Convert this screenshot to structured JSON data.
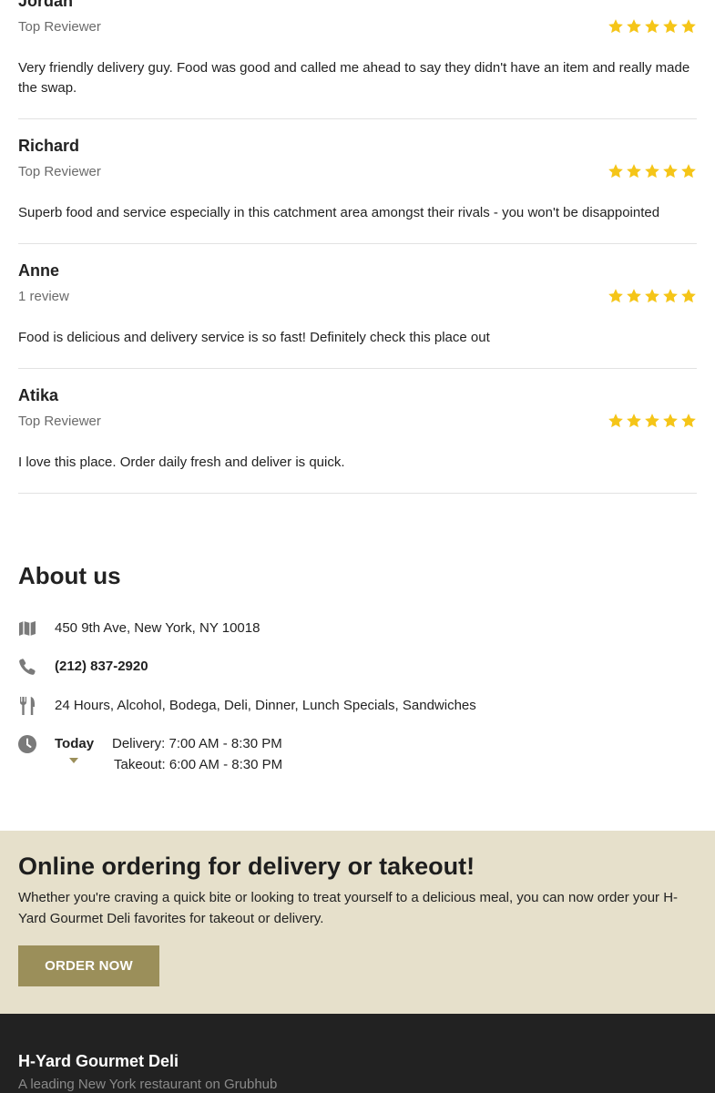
{
  "reviews": [
    {
      "name": "Jordan",
      "badge": "Top Reviewer",
      "rating": 5,
      "text": "Very friendly delivery guy. Food was good and called me ahead to say they didn't have an item and really made the swap."
    },
    {
      "name": "Richard",
      "badge": "Top Reviewer",
      "rating": 5,
      "text": "Superb food and service especially in this catchment area amongst their rivals - you won't be disappointed"
    },
    {
      "name": "Anne",
      "badge": "1 review",
      "rating": 5,
      "text": "Food is delicious and delivery service is so fast! Definitely check this place out"
    },
    {
      "name": "Atika",
      "badge": "Top Reviewer",
      "rating": 5,
      "text": "I love this place. Order daily fresh and deliver is quick."
    }
  ],
  "about": {
    "title": "About us",
    "address": "450 9th Ave, New York, NY 10018",
    "phone": "(212) 837-2920",
    "categories": "24 Hours, Alcohol, Bodega, Deli, Dinner, Lunch Specials, Sandwiches",
    "hours": {
      "day": "Today",
      "delivery": "Delivery: 7:00 AM - 8:30 PM",
      "takeout": "Takeout: 6:00 AM - 8:30 PM"
    }
  },
  "ordering": {
    "title": "Online ordering for delivery or takeout!",
    "text": "Whether you're craving a quick bite or looking to treat yourself to a delicious meal, you can now order your H-Yard Gourmet Deli favorites for takeout or delivery.",
    "button_label": "ORDER NOW"
  },
  "footer": {
    "title": "H-Yard Gourmet Deli",
    "subtitle": "A leading New York restaurant on Grubhub"
  },
  "icons": {
    "star": "star-icon",
    "address": "map-icon",
    "phone": "phone-icon",
    "categories": "utensils-icon",
    "hours": "clock-icon",
    "expand": "caret-down-icon"
  },
  "colors": {
    "star": "#f5c518",
    "accent": "#9b8f5a",
    "ordering_bg": "#e6e0cb",
    "footer_bg": "#222222",
    "icon": "#7a7a7a"
  }
}
